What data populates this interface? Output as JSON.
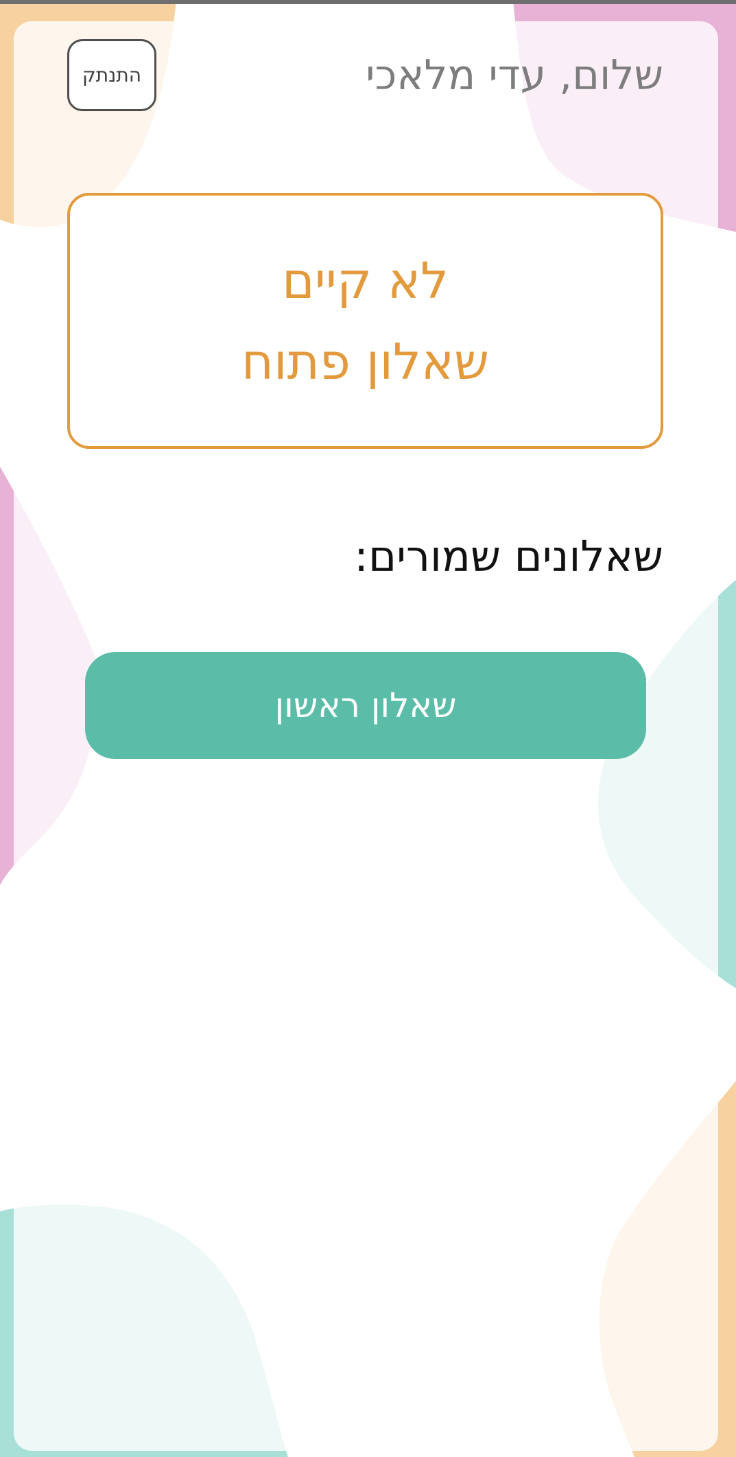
{
  "header": {
    "greeting": "שלום, עדי מלאכי",
    "logout_label": "התנתק"
  },
  "status_box": {
    "line1": "לא קיים",
    "line2": "שאלון פתוח"
  },
  "saved_section": {
    "heading": "שאלונים שמורים:",
    "items": [
      {
        "label": "שאלון ראשון"
      }
    ]
  },
  "colors": {
    "accent_orange": "#e29a3c",
    "teal": "#5bbca8",
    "blob_peach": "#f7d19f",
    "blob_pink": "#e8b1d6",
    "blob_mint": "#a8e0d8"
  }
}
